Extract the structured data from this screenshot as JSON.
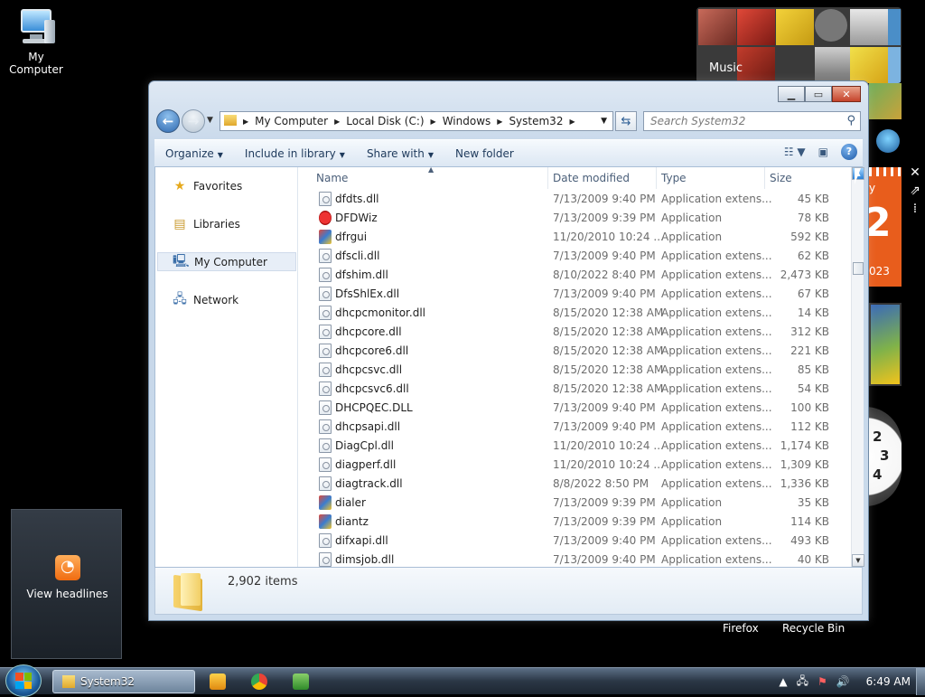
{
  "desktop": {
    "my_computer_label": "My Computer",
    "media_gadget_label": "Music",
    "rss_label": "View headlines",
    "firefox_label": "Firefox",
    "recycle_label": "Recycle Bin",
    "clock_nums": [
      "2",
      "3",
      "4"
    ],
    "calendar_suffix": "023",
    "calendar_day": "y"
  },
  "window": {
    "address": [
      "My Computer",
      "Local Disk (C:)",
      "Windows",
      "System32"
    ],
    "search_placeholder": "Search System32",
    "toolbar": {
      "organize": "Organize",
      "include": "Include in library",
      "share": "Share with",
      "new_folder": "New folder"
    },
    "nav": [
      {
        "label": "Favorites",
        "icon": "star-icon"
      },
      {
        "label": "Libraries",
        "icon": "libraries-icon"
      },
      {
        "label": "My Computer",
        "icon": "computer-icon",
        "selected": true
      },
      {
        "label": "Network",
        "icon": "network-icon"
      }
    ],
    "columns": {
      "name": "Name",
      "date": "Date modified",
      "type": "Type",
      "size": "Size"
    },
    "files": [
      {
        "name": "dfdts.dll",
        "date": "7/13/2009 9:40 PM",
        "type": "Application extens...",
        "size": "45 KB"
      },
      {
        "name": "DFDWiz",
        "date": "7/13/2009 9:39 PM",
        "type": "Application",
        "size": "78 KB"
      },
      {
        "name": "dfrgui",
        "date": "11/20/2010 10:24 ...",
        "type": "Application",
        "size": "592 KB"
      },
      {
        "name": "dfscli.dll",
        "date": "7/13/2009 9:40 PM",
        "type": "Application extens...",
        "size": "62 KB"
      },
      {
        "name": "dfshim.dll",
        "date": "8/10/2022 8:40 PM",
        "type": "Application extens...",
        "size": "2,473 KB"
      },
      {
        "name": "DfsShlEx.dll",
        "date": "7/13/2009 9:40 PM",
        "type": "Application extens...",
        "size": "67 KB"
      },
      {
        "name": "dhcpcmonitor.dll",
        "date": "8/15/2020 12:38 AM",
        "type": "Application extens...",
        "size": "14 KB"
      },
      {
        "name": "dhcpcore.dll",
        "date": "8/15/2020 12:38 AM",
        "type": "Application extens...",
        "size": "312 KB"
      },
      {
        "name": "dhcpcore6.dll",
        "date": "8/15/2020 12:38 AM",
        "type": "Application extens...",
        "size": "221 KB"
      },
      {
        "name": "dhcpcsvc.dll",
        "date": "8/15/2020 12:38 AM",
        "type": "Application extens...",
        "size": "85 KB"
      },
      {
        "name": "dhcpcsvc6.dll",
        "date": "8/15/2020 12:38 AM",
        "type": "Application extens...",
        "size": "54 KB"
      },
      {
        "name": "DHCPQEC.DLL",
        "date": "7/13/2009 9:40 PM",
        "type": "Application extens...",
        "size": "100 KB"
      },
      {
        "name": "dhcpsapi.dll",
        "date": "7/13/2009 9:40 PM",
        "type": "Application extens...",
        "size": "112 KB"
      },
      {
        "name": "DiagCpl.dll",
        "date": "11/20/2010 10:24 ...",
        "type": "Application extens...",
        "size": "1,174 KB"
      },
      {
        "name": "diagperf.dll",
        "date": "11/20/2010 10:24 ...",
        "type": "Application extens...",
        "size": "1,309 KB"
      },
      {
        "name": "diagtrack.dll",
        "date": "8/8/2022 8:50 PM",
        "type": "Application extens...",
        "size": "1,336 KB"
      },
      {
        "name": "dialer",
        "date": "7/13/2009 9:39 PM",
        "type": "Application",
        "size": "35 KB"
      },
      {
        "name": "diantz",
        "date": "7/13/2009 9:39 PM",
        "type": "Application",
        "size": "114 KB"
      },
      {
        "name": "difxapi.dll",
        "date": "7/13/2009 9:40 PM",
        "type": "Application extens...",
        "size": "493 KB"
      },
      {
        "name": "dimsjob.dll",
        "date": "7/13/2009 9:40 PM",
        "type": "Application extens...",
        "size": "40 KB"
      }
    ],
    "item_count": "2,902 items"
  },
  "taskbar": {
    "task_label": "System32",
    "time": "6:49 AM"
  },
  "colors": {
    "accent": "#2f69b0",
    "rss": "#f06b10",
    "calendar": "#e85d1c"
  }
}
